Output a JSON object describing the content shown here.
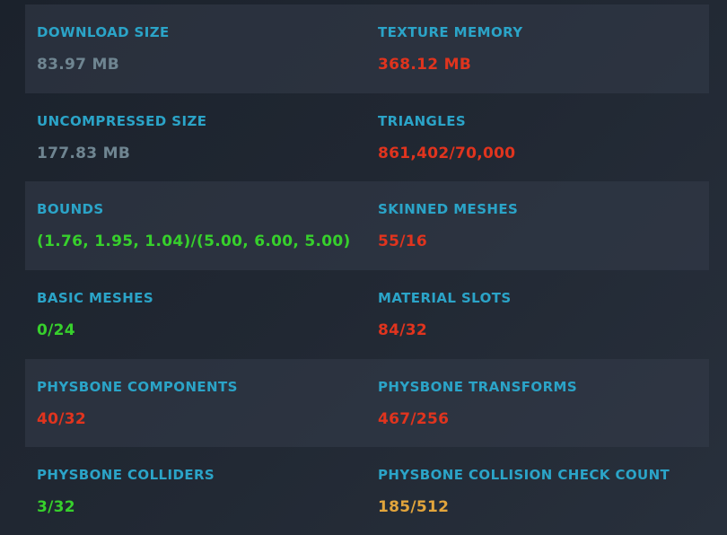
{
  "colors": {
    "label": "#2ba4c8",
    "neutral": "#6f8591",
    "bad": "#e0341e",
    "good": "#37d02c",
    "warn": "#e2a53c"
  },
  "stats": [
    {
      "label": "DOWNLOAD SIZE",
      "value": "83.97 MB",
      "status": "neutral"
    },
    {
      "label": "TEXTURE MEMORY",
      "value": "368.12 MB",
      "status": "bad"
    },
    {
      "label": "UNCOMPRESSED SIZE",
      "value": "177.83 MB",
      "status": "neutral"
    },
    {
      "label": "TRIANGLES",
      "value": "861,402/70,000",
      "status": "bad"
    },
    {
      "label": "BOUNDS",
      "value": "(1.76, 1.95, 1.04)/(5.00, 6.00, 5.00)",
      "status": "good"
    },
    {
      "label": "SKINNED MESHES",
      "value": "55/16",
      "status": "bad"
    },
    {
      "label": "BASIC MESHES",
      "value": "0/24",
      "status": "good"
    },
    {
      "label": "MATERIAL SLOTS",
      "value": "84/32",
      "status": "bad"
    },
    {
      "label": "PHYSBONE COMPONENTS",
      "value": "40/32",
      "status": "bad"
    },
    {
      "label": "PHYSBONE TRANSFORMS",
      "value": "467/256",
      "status": "bad"
    },
    {
      "label": "PHYSBONE COLLIDERS",
      "value": "3/32",
      "status": "good"
    },
    {
      "label": "PHYSBONE COLLISION CHECK COUNT",
      "value": "185/512",
      "status": "warn"
    }
  ]
}
